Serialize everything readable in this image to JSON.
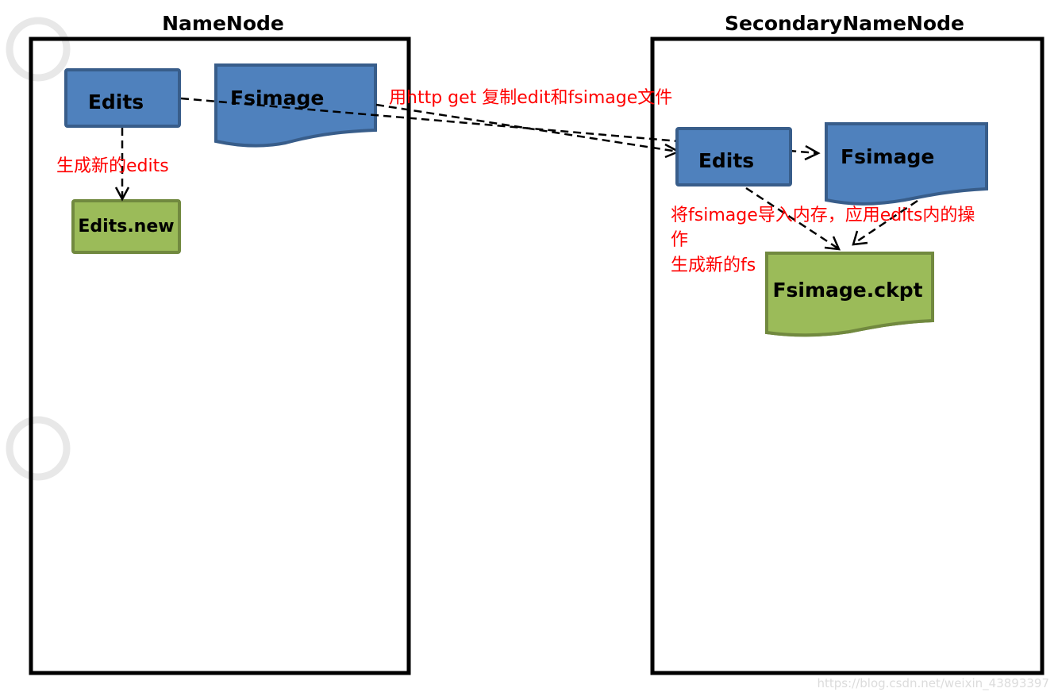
{
  "panels": {
    "left_title": "NameNode",
    "right_title": "SecondaryNameNode"
  },
  "nodes": {
    "nn_edits": "Edits",
    "nn_fsimage": "Fsimage",
    "nn_edits_new": "Edits.new",
    "snn_edits": "Edits",
    "snn_fsimage": "Fsimage",
    "snn_fsimage_ckpt": "Fsimage.ckpt"
  },
  "annotations": {
    "generate_new_edits": "生成新的edits",
    "http_get_copy": "用http get 复制edit和fsimage文件",
    "merge_line1": "将fsimage导入内存，应用edits内的操",
    "merge_line2": "作",
    "merge_line3": "生成新的fs"
  },
  "colors": {
    "storage_blue": "#4f81bd",
    "storage_blue_border": "#385d8a",
    "new_green": "#9bbb59",
    "new_green_border": "#71893f",
    "annotation_red": "#ff0000"
  },
  "watermark": "https://blog.csdn.net/weixin_43893397"
}
